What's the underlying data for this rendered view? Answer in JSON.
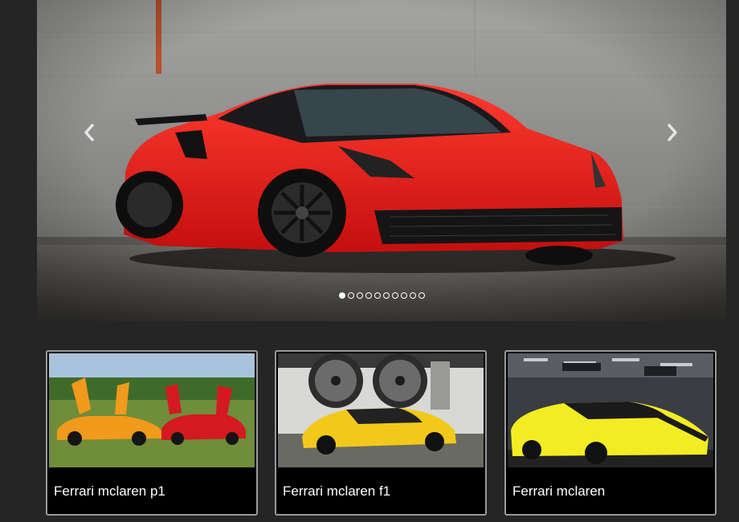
{
  "slider": {
    "image_alt": "Red Ferrari sports car in front of concrete wall",
    "prev_icon": "chevron-left-icon",
    "next_icon": "chevron-right-icon",
    "slide_count": 10,
    "active_index": 0
  },
  "cards": [
    {
      "title": "Ferrari mclaren p1",
      "image_alt": "Orange and red supercars with open doors on grass"
    },
    {
      "title": "Ferrari mclaren f1",
      "image_alt": "Yellow supercar under jet engines"
    },
    {
      "title": "Ferrari mclaren",
      "image_alt": "Yellow Ferrari at an auto show"
    }
  ],
  "colors": {
    "page_bg": "#252525",
    "card_border": "#9a9a9a",
    "caption_bg": "#000000",
    "caption_text": "#ffffff",
    "hero_car": "#e31b1b"
  }
}
